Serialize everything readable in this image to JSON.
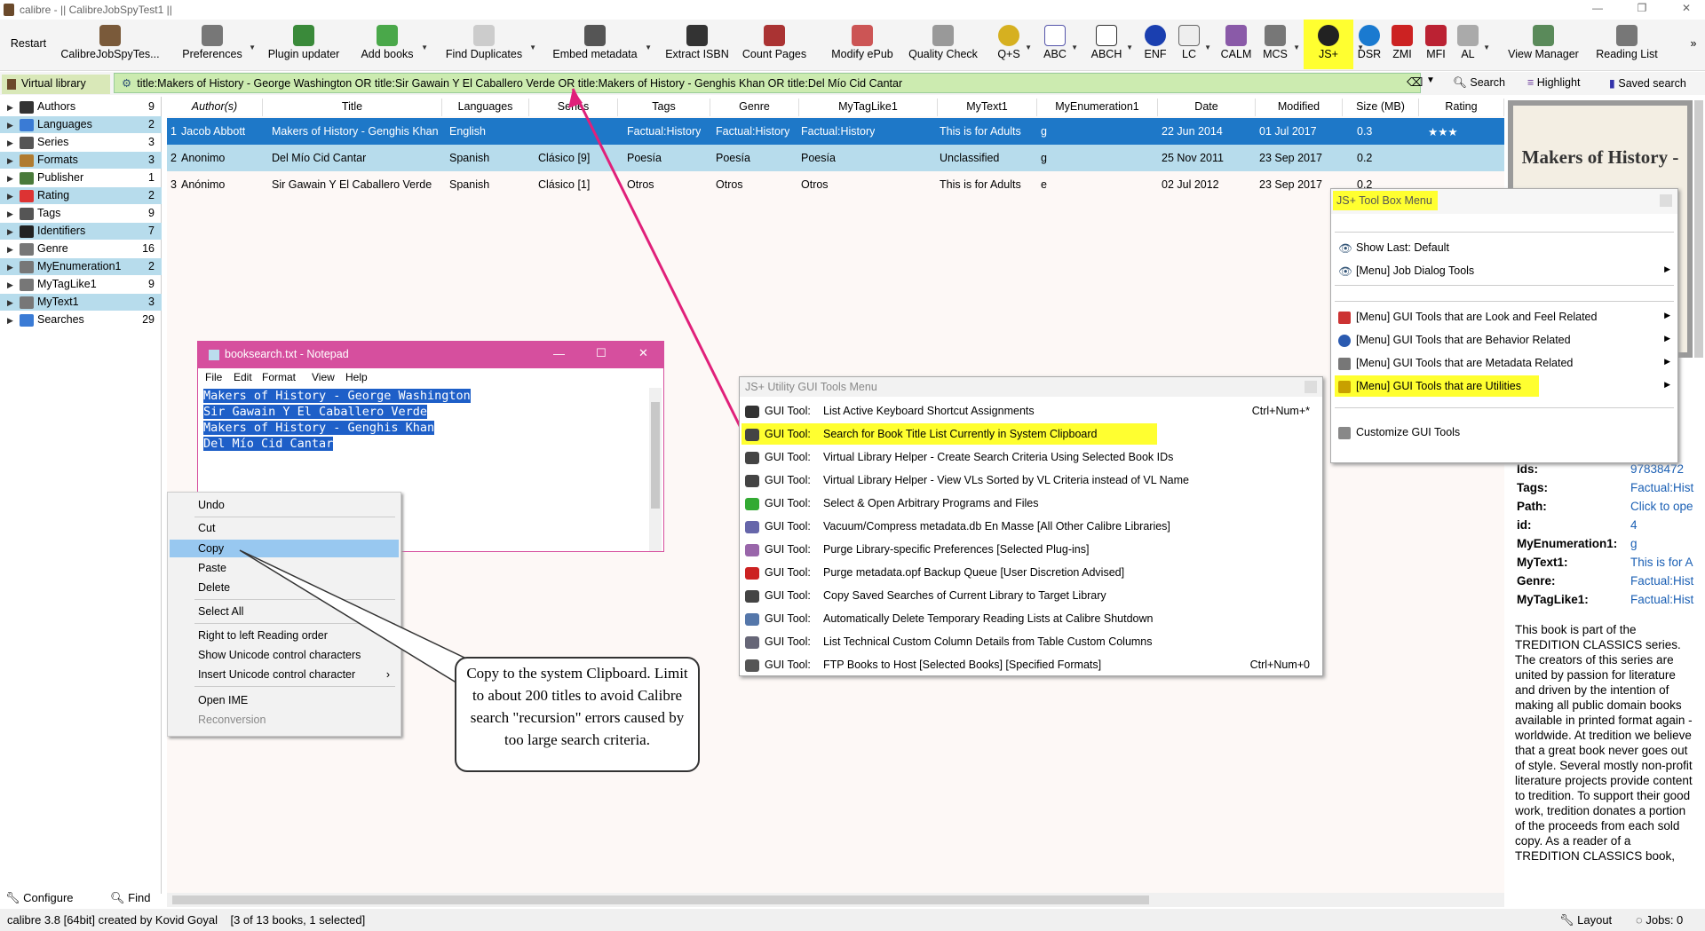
{
  "window": {
    "title": "calibre - || CalibreJobSpyTest1 ||"
  },
  "toolbar": {
    "restart": "Restart",
    "library": "CalibreJobSpyTes...",
    "preferences": "Preferences",
    "plugin_updater": "Plugin updater",
    "add_books": "Add books",
    "find_duplicates": "Find Duplicates",
    "embed_metadata": "Embed metadata",
    "extract_isbn": "Extract ISBN",
    "count_pages": "Count Pages",
    "modify_epub": "Modify ePub",
    "quality_check": "Quality Check",
    "qs": "Q+S",
    "abc": "ABC",
    "abch": "ABCH",
    "enf": "ENF",
    "lc": "LC",
    "calm": "CALM",
    "mcs": "MCS",
    "js": "JS+",
    "dsr": "DSR",
    "zmi": "ZMI",
    "mfi": "MFI",
    "al": "AL",
    "view_manager": "View Manager",
    "reading_list": "Reading List"
  },
  "vlbar": {
    "virtual_library": "Virtual library",
    "search_query": "title:Makers of History - George Washington OR title:Sir Gawain Y El Caballero Verde OR title:Makers of History - Genghis Khan OR title:Del Mío Cid Cantar",
    "search_btn": "Search",
    "highlight_btn": "Highlight",
    "saved_search_btn": "Saved search"
  },
  "tag_browser": {
    "items": [
      {
        "label": "Authors",
        "count": "9",
        "hl": false,
        "color": "#333"
      },
      {
        "label": "Languages",
        "count": "2",
        "hl": true,
        "color": "#3a7bd5"
      },
      {
        "label": "Series",
        "count": "3",
        "hl": false,
        "color": "#555"
      },
      {
        "label": "Formats",
        "count": "3",
        "hl": true,
        "color": "#b07b30"
      },
      {
        "label": "Publisher",
        "count": "1",
        "hl": false,
        "color": "#4a7a3a"
      },
      {
        "label": "Rating",
        "count": "2",
        "hl": true,
        "color": "#d33"
      },
      {
        "label": "Tags",
        "count": "9",
        "hl": false,
        "color": "#555"
      },
      {
        "label": "Identifiers",
        "count": "7",
        "hl": true,
        "color": "#222"
      },
      {
        "label": "Genre",
        "count": "16",
        "hl": false,
        "color": "#777"
      },
      {
        "label": "MyEnumeration1",
        "count": "2",
        "hl": true,
        "color": "#777"
      },
      {
        "label": "MyTagLike1",
        "count": "9",
        "hl": false,
        "color": "#777"
      },
      {
        "label": "MyText1",
        "count": "3",
        "hl": true,
        "color": "#777"
      },
      {
        "label": "Searches",
        "count": "29",
        "hl": false,
        "color": "#3a7bd5"
      }
    ],
    "configure": "Configure",
    "find": "Find"
  },
  "booklist": {
    "headers": [
      "Author(s)",
      "Title",
      "Languages",
      "Series",
      "Tags",
      "Genre",
      "MyTagLike1",
      "MyText1",
      "MyEnumeration1",
      "Date",
      "Modified",
      "Size (MB)",
      "Rating"
    ],
    "rows": [
      {
        "num": "1",
        "author": "Jacob Abbott",
        "title": "Makers of History - Genghis Khan",
        "lang": "English",
        "series": "",
        "tags": "Factual:History",
        "genre": "Factual:History",
        "taglike": "Factual:History",
        "text1": "This is for Adults",
        "enum": "g",
        "date": "22 Jun 2014",
        "modified": "01 Jul 2017",
        "size": "0.3",
        "rating": "★★★"
      },
      {
        "num": "2",
        "author": "Anonimo",
        "title": "Del Mío Cid Cantar",
        "lang": "Spanish",
        "series": "Clásico [9]",
        "tags": "Poesía",
        "genre": "Poesía",
        "taglike": "Poesía",
        "text1": "Unclassified",
        "enum": "g",
        "date": "25 Nov 2011",
        "modified": "23 Sep 2017",
        "size": "0.2",
        "rating": ""
      },
      {
        "num": "3",
        "author": "Anónimo",
        "title": "Sir Gawain Y El Caballero Verde",
        "lang": "Spanish",
        "series": "Clásico [1]",
        "tags": "Otros",
        "genre": "Otros",
        "taglike": "Otros",
        "text1": "This is for Adults",
        "enum": "e",
        "date": "02 Jul 2012",
        "modified": "23 Sep 2017",
        "size": "0.2",
        "rating": ""
      }
    ]
  },
  "notepad": {
    "title": "booksearch.txt - Notepad",
    "menu": [
      "File",
      "Edit",
      "Format",
      "View",
      "Help"
    ],
    "lines": [
      "Makers of History - George Washington",
      "Sir Gawain Y El Caballero Verde",
      "Makers of History - Genghis Khan",
      "Del Mío Cid Cantar"
    ]
  },
  "context_menu": {
    "undo": "Undo",
    "cut": "Cut",
    "copy": "Copy",
    "paste": "Paste",
    "delete": "Delete",
    "select_all": "Select All",
    "rtl": "Right to left Reading order",
    "show_unicode": "Show Unicode control characters",
    "insert_unicode": "Insert Unicode control character",
    "open_ime": "Open IME",
    "reconversion": "Reconversion"
  },
  "callout": {
    "text": "Copy to the system Clipboard. Limit to about 200 titles to avoid Calibre search \"recursion\" errors caused by too large search criteria."
  },
  "util_menu": {
    "title": "JS+ Utility GUI Tools Menu",
    "prefix": "GUI Tool:",
    "items": [
      {
        "label": "List Active Keyboard Shortcut Assignments",
        "shortcut": "Ctrl+Num+*",
        "icon_color": "#333",
        "hl": false
      },
      {
        "label": "Search for Book Title List Currently in System Clipboard",
        "shortcut": "",
        "icon_color": "#444",
        "hl": true
      },
      {
        "label": "Virtual Library Helper - Create Search Criteria Using Selected Book IDs",
        "shortcut": "",
        "icon_color": "#444",
        "hl": false
      },
      {
        "label": "Virtual Library Helper - View VLs Sorted by VL Criteria instead of VL Name",
        "shortcut": "",
        "icon_color": "#444",
        "hl": false
      },
      {
        "label": "Select & Open Arbitrary Programs and Files",
        "shortcut": "",
        "icon_color": "#3a3",
        "hl": false
      },
      {
        "label": "Vacuum/Compress metadata.db En Masse [All Other Calibre Libraries]",
        "shortcut": "",
        "icon_color": "#66a",
        "hl": false
      },
      {
        "label": "Purge Library-specific Preferences [Selected Plug-ins]",
        "shortcut": "",
        "icon_color": "#96a",
        "hl": false
      },
      {
        "label": "Purge metadata.opf Backup Queue [User Discretion Advised]",
        "shortcut": "",
        "icon_color": "#c22",
        "hl": false
      },
      {
        "label": "Copy Saved Searches of Current Library to Target Library",
        "shortcut": "",
        "icon_color": "#444",
        "hl": false
      },
      {
        "label": "Automatically Delete Temporary Reading Lists at Calibre Shutdown",
        "shortcut": "",
        "icon_color": "#57a",
        "hl": false
      },
      {
        "label": "List Technical Custom Column Details from Table Custom Columns",
        "shortcut": "",
        "icon_color": "#667",
        "hl": false
      },
      {
        "label": "FTP Books to Host [Selected Books] [Specified Formats]",
        "shortcut": "Ctrl+Num+0",
        "icon_color": "#555",
        "hl": false
      }
    ]
  },
  "js_menu": {
    "title": "JS+ Tool Box Menu",
    "show_last": "Show Last: Default",
    "job_dialog": "[Menu] Job Dialog Tools",
    "look_feel": "[Menu] GUI Tools that are Look and Feel Related",
    "behavior": "[Menu] GUI Tools that are Behavior Related",
    "metadata": "[Menu] GUI Tools that are Metadata Related",
    "utilities": "[Menu] GUI Tools that are Utilities",
    "customize": "Customize GUI Tools"
  },
  "right_panel": {
    "book_title": "Makers of History -",
    "fields": [
      {
        "name": "Ids:",
        "value": "97838472"
      },
      {
        "name": "Tags:",
        "value": "Factual:Hist"
      },
      {
        "name": "Path:",
        "value": "Click to ope"
      },
      {
        "name": "id:",
        "value": "4"
      },
      {
        "name": "MyEnumeration1:",
        "value": "g"
      },
      {
        "name": "MyText1:",
        "value": "This is for A"
      },
      {
        "name": "Genre:",
        "value": "Factual:Hist"
      },
      {
        "name": "MyTagLike1:",
        "value": "Factual:Hist"
      }
    ],
    "description": "This book is part of the TREDITION CLASSICS series. The creators of this series are united by passion for literature and driven by the intention of making all public domain books available in printed format again - worldwide. At tredition we believe that a great book never goes out of style. Several mostly non-profit literature projects provide content to tredition. To support their good work, tredition donates a portion of the proceeds from each sold copy. As a reader of a TREDITION CLASSICS book,"
  },
  "status": {
    "left": "calibre 3.8 [64bit] created by Kovid Goyal    [3 of 13 books, 1 selected]",
    "layout": "Layout",
    "jobs": "Jobs: 0"
  }
}
